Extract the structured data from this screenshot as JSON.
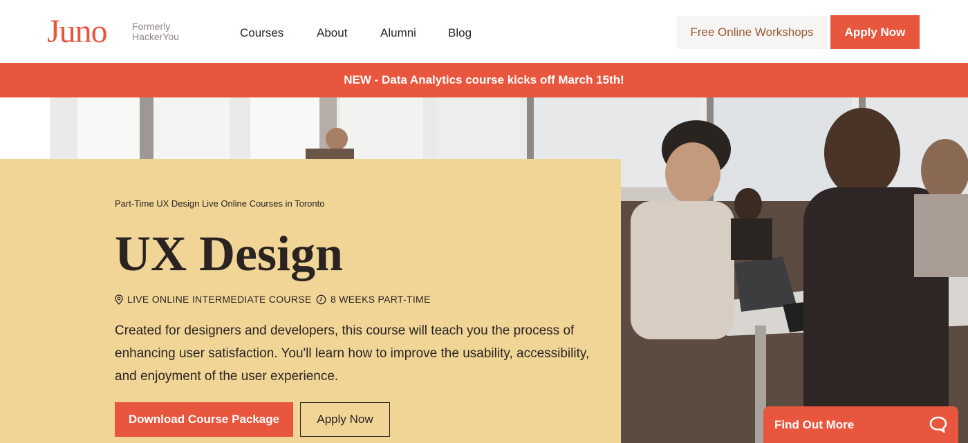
{
  "header": {
    "logo": "Juno",
    "logo_sub_1": "Formerly",
    "logo_sub_2": "HackerYou",
    "nav": [
      "Courses",
      "About",
      "Alumni",
      "Blog"
    ],
    "workshops_label": "Free Online Workshops",
    "apply_label": "Apply Now"
  },
  "announcement": "NEW - Data Analytics course kicks off March 15th!",
  "hero": {
    "eyebrow": "Part-Time UX Design Live Online Courses in Toronto",
    "title": "UX Design",
    "meta_location": "LIVE ONLINE INTERMEDIATE COURSE",
    "meta_duration": "8 WEEKS PART-TIME",
    "description": "Created for designers and developers, this course will teach you the process of enhancing user satisfaction. You'll learn how to improve the usability, accessibility, and enjoyment of the user experience.",
    "download_label": "Download Course Package",
    "apply_label": "Apply Now"
  },
  "widget": {
    "label": "Find Out More",
    "icon": "chat-icon"
  },
  "colors": {
    "brand": "#e8563d",
    "panel": "#f0d597",
    "text": "#2b2321"
  }
}
